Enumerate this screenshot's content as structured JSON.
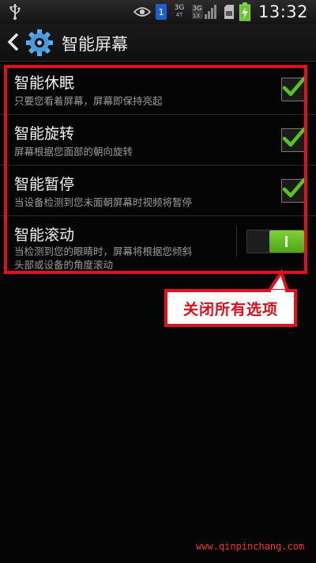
{
  "status_bar": {
    "network_badge_1": "3G",
    "network_badge_1_sub": "4T",
    "sim_number": "1",
    "network_badge_2": "3G",
    "network_badge_2_sub": "1X",
    "time": "13:32",
    "icons": [
      "usb-icon",
      "eye-icon",
      "sim-icon",
      "signal-icon",
      "battery-charging-icon"
    ]
  },
  "header": {
    "title": "智能屏幕",
    "icons": [
      "back-chevron-icon",
      "gear-icon"
    ]
  },
  "settings": {
    "items": [
      {
        "title": "智能休眠",
        "subtitle": "只要您看着屏幕，屏幕即保持亮起",
        "checked": true
      },
      {
        "title": "智能旋转",
        "subtitle": "屏幕根据您面部的朝向旋转",
        "checked": true
      },
      {
        "title": "智能暂停",
        "subtitle": "当设备检测到您未面朝屏幕时视频将暂停",
        "checked": true
      },
      {
        "title": "智能滚动",
        "subtitle_line1": "当检测到您的眼睛时，屏幕将根据您倾斜",
        "subtitle_line2": "头部或设备的角度滚动",
        "toggle_on": true
      }
    ]
  },
  "annotation": {
    "callout_text": "关闭所有选项",
    "highlight_color": "#e0101e"
  },
  "watermark": "www.qinpinchang.com",
  "colors": {
    "check_green": "#58c51f",
    "toggle_green": "#6cc22b"
  }
}
